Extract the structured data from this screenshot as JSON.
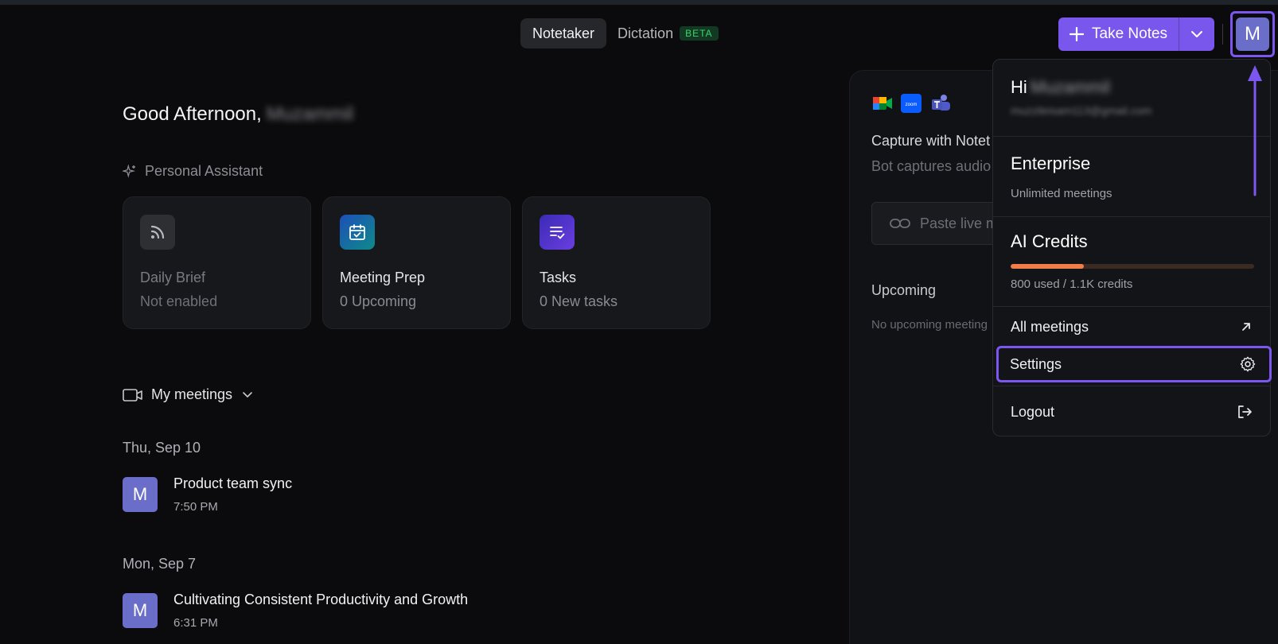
{
  "header": {
    "tabs": [
      {
        "label": "Notetaker",
        "active": true
      },
      {
        "label": "Dictation",
        "badge": "BETA"
      }
    ],
    "take_notes_label": "Take Notes",
    "avatar_initial": "M"
  },
  "greeting": {
    "text": "Good Afternoon,",
    "name": "Muzammil"
  },
  "assistant": {
    "section_label": "Personal Assistant",
    "cards": [
      {
        "title": "Daily Brief",
        "subtitle": "Not enabled",
        "icon": "rss-icon"
      },
      {
        "title": "Meeting Prep",
        "subtitle": "0 Upcoming",
        "icon": "calendar-check-icon"
      },
      {
        "title": "Tasks",
        "subtitle": "0 New tasks",
        "icon": "checklist-icon"
      }
    ]
  },
  "meetings": {
    "filter_label": "My meetings",
    "groups": [
      {
        "date": "Thu, Sep 10",
        "items": [
          {
            "initial": "M",
            "title": "Product team sync",
            "time": "7:50 PM"
          }
        ]
      },
      {
        "date": "Mon, Sep 7",
        "items": [
          {
            "initial": "M",
            "title": "Cultivating Consistent Productivity and Growth",
            "time": "6:31 PM"
          }
        ]
      }
    ]
  },
  "capture": {
    "title": "Capture with Notet",
    "subtitle": "Bot captures audio",
    "paste_placeholder": "Paste live m",
    "upcoming_label": "Upcoming",
    "no_upcoming": "No upcoming meeting",
    "platform_icons": [
      "google-meet-icon",
      "zoom-icon",
      "teams-icon"
    ]
  },
  "account_menu": {
    "greeting": "Hi",
    "name": "Muzammil",
    "email": "muzzileisam113@gmail.com",
    "plan": "Enterprise",
    "plan_detail": "Unlimited meetings",
    "credits_title": "AI Credits",
    "credits_used_fraction": 0.3,
    "credits_text": "800 used / 1.1K credits",
    "items": [
      {
        "label": "All meetings",
        "icon": "arrow-up-right-icon"
      },
      {
        "label": "Settings",
        "icon": "gear-icon",
        "highlighted": true
      },
      {
        "label": "Logout",
        "icon": "logout-icon"
      }
    ]
  },
  "colors": {
    "accent": "#7a57ec",
    "credit_bar": "#f07d4a",
    "background": "#0b0b0d"
  }
}
